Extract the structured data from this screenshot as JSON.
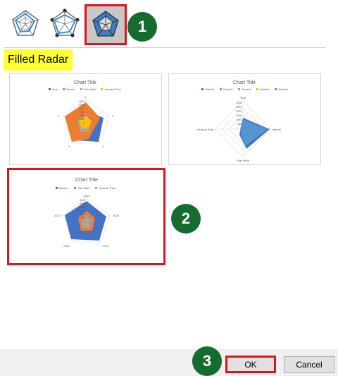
{
  "chart_types": [
    {
      "name": "Radar",
      "icon": "radar-icon"
    },
    {
      "name": "Radar with Markers",
      "icon": "radar-markers-icon"
    },
    {
      "name": "Filled Radar",
      "icon": "filled-radar-icon",
      "selected": true
    }
  ],
  "steps": [
    "1",
    "2",
    "3"
  ],
  "selected_type_label": "Filled Radar",
  "previews": [
    {
      "title": "Chart Title",
      "legend": [
        "Year",
        "Marvel",
        "Star Wars",
        "Jurassic Park"
      ],
      "legend_colors": [
        "#4472c4",
        "#ed7d31",
        "#a5a5a5",
        "#ffc000"
      ],
      "axes": [
        "1",
        "2",
        "3",
        "4",
        "5"
      ],
      "ticks": [
        "3000",
        "2500",
        "2000",
        "1500",
        "1000",
        "500",
        "0"
      ]
    },
    {
      "title": "Chart Title",
      "legend": [
        "Series1",
        "Series2",
        "Series3",
        "Series4",
        "Series5"
      ],
      "legend_colors": [
        "#4472c4",
        "#ed7d31",
        "#a5a5a5",
        "#ffc000",
        "#5b9bd5"
      ],
      "axes": [
        "Year",
        "Marvel",
        "Star Wars",
        "Jurassic Park"
      ],
      "ticks": [
        "3000",
        "2500",
        "2000",
        "1500",
        "1000",
        "500",
        "0"
      ]
    },
    {
      "title": "Chart Title",
      "legend": [
        "Marvel",
        "Star Wars",
        "Jurassic Park"
      ],
      "legend_colors": [
        "#4472c4",
        "#ed7d31",
        "#a5a5a5"
      ],
      "axes": [
        "2019",
        "2020",
        "2021",
        "2022",
        "2023"
      ],
      "ticks": [
        "3000",
        "2500",
        "2000",
        "1500",
        "1000",
        "500",
        "0"
      ]
    }
  ],
  "buttons": {
    "ok": "OK",
    "cancel": "Cancel"
  },
  "colors": {
    "accent_red": "#e0121a",
    "badge_green": "#146c2e",
    "highlight_yellow": "#ffff33"
  }
}
